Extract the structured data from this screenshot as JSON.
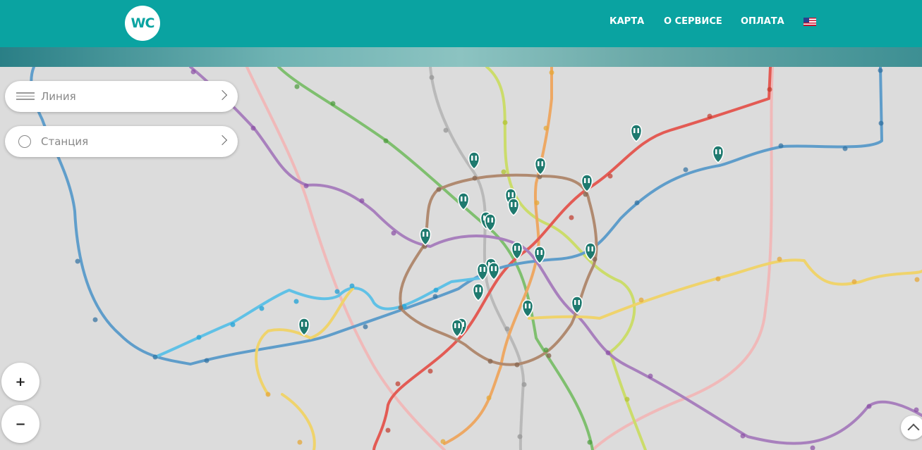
{
  "header": {
    "logo_text": "WC",
    "nav": [
      "КАРТА",
      "О СЕРВИСЕ",
      "ОПЛАТА"
    ],
    "language_flag": "us-flag-icon"
  },
  "filters": {
    "line_placeholder": "Линия",
    "station_placeholder": "Станция"
  },
  "zoom": {
    "in_label": "+",
    "out_label": "−"
  },
  "colors": {
    "header": "#0aa3a1",
    "marker": "#1f7a6f",
    "map_background": "#dcdcdc"
  },
  "icons": {
    "toilet_marker": "toilet-marker-icon",
    "scroll_top": "chevron-up-icon"
  }
}
